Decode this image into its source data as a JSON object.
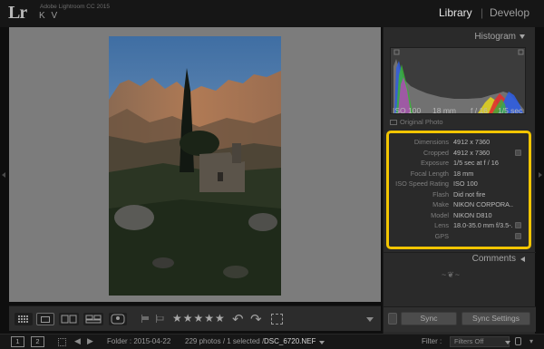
{
  "top_bar": {
    "logo": "Lr",
    "app_title": "Adobe Lightroom CC 2015",
    "user_initials": "K V",
    "modules": [
      "Library",
      "|",
      "Develop"
    ],
    "active_module": "Library"
  },
  "photo": {
    "description_icon": "landscape-photo"
  },
  "toolbar": {
    "view_modes": [
      "grid-view",
      "loupe-view",
      "compare-view",
      "survey-view",
      "people-view"
    ],
    "active_view": "loupe-view",
    "rating": "★★★★★",
    "rotate_left": "↶",
    "rotate_right": "↷"
  },
  "histogram": {
    "title": "Histogram",
    "iso": "ISO 100",
    "focal_length": "18 mm",
    "aperture": "f / 16",
    "shutter": "1/5 sec",
    "original_photo_label": "Original Photo",
    "colors": {
      "red": "#e03030",
      "green": "#3ab33a",
      "blue": "#2f5de0",
      "yellow": "#e0d020",
      "magenta": "#c040c0",
      "luminance": "#9a9a9a"
    }
  },
  "metadata": {
    "highlight_color": "#f2c500",
    "rows": [
      {
        "label": "Dimensions",
        "value": "4912 x 7360",
        "button": false
      },
      {
        "label": "Cropped",
        "value": "4912 x 7360",
        "button": true
      },
      {
        "label": "Exposure",
        "value": "1/5 sec at f / 16",
        "button": false
      },
      {
        "label": "Focal Length",
        "value": "18 mm",
        "button": false
      },
      {
        "label": "ISO Speed Rating",
        "value": "ISO 100",
        "button": false
      },
      {
        "label": "Flash",
        "value": "Did not fire",
        "button": false
      },
      {
        "label": "Make",
        "value": "NIKON CORPORA...",
        "button": false
      },
      {
        "label": "Model",
        "value": "NIKON D810",
        "button": false
      },
      {
        "label": "Lens",
        "value": "18.0-35.0 mm f/3.5-...",
        "button": true
      },
      {
        "label": "GPS",
        "value": "",
        "button": true
      }
    ]
  },
  "comments": {
    "title": "Comments"
  },
  "panel_end_ornament": "~❦~",
  "sync": {
    "sync_label": "Sync",
    "sync_settings_label": "Sync Settings"
  },
  "filmstrip": {
    "screen_1": "1",
    "screen_2": "2",
    "nav_back": "◀",
    "nav_forward": "▶",
    "folder_path": "Folder : 2015-04-22",
    "selection_info": "229 photos / 1 selected /",
    "selected_file": "DSC_6720.NEF",
    "filter_label": "Filter :",
    "filter_value": "Filters Off"
  }
}
